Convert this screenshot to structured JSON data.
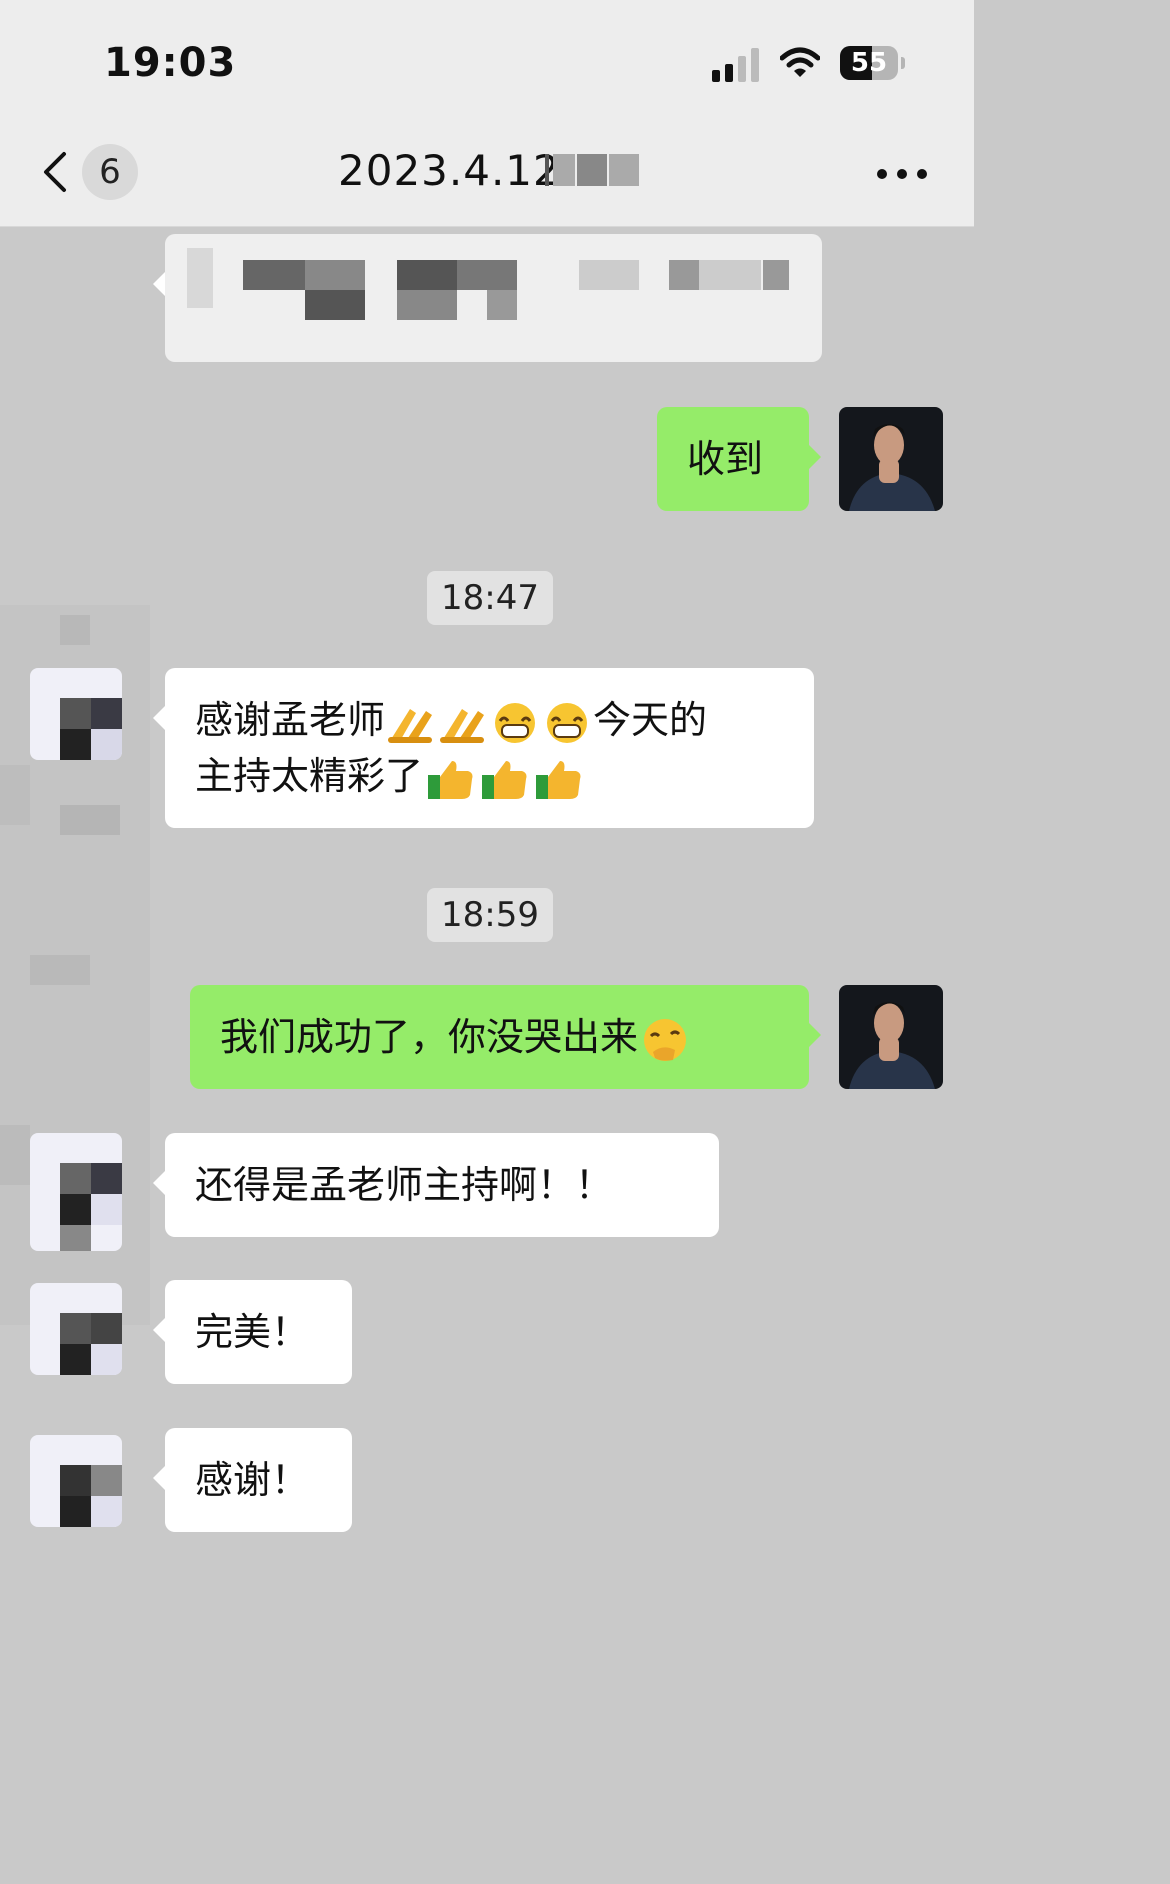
{
  "status_bar": {
    "time": "19:03",
    "battery_level": "55",
    "battery_fraction": 0.55
  },
  "nav": {
    "unread_count": "6",
    "title": "2023.4.12",
    "back_icon": "chevron-left-icon",
    "more_icon": "more-dots-icon"
  },
  "messages": [
    {
      "side": "right",
      "type": "text",
      "text": "收到"
    },
    {
      "type": "time",
      "text": "18:47"
    },
    {
      "side": "left",
      "type": "text",
      "text": [
        "感谢孟老师",
        "今天的",
        "主持太精彩了"
      ],
      "emoji": [
        "raised-hands-emoji",
        "raised-hands-emoji",
        "grinning-emoji",
        "grinning-emoji",
        "thumbs-up-emoji",
        "thumbs-up-emoji",
        "thumbs-up-emoji"
      ]
    },
    {
      "type": "time",
      "text": "18:59"
    },
    {
      "side": "right",
      "type": "text",
      "text": "我们成功了，你没哭出来",
      "emoji": [
        "blushing-hand-emoji"
      ]
    },
    {
      "side": "left",
      "type": "text",
      "text": "还得是孟老师主持啊！！"
    },
    {
      "side": "left",
      "type": "text",
      "text": "完美！"
    },
    {
      "side": "left",
      "type": "text",
      "text": "感谢！"
    }
  ],
  "colors": {
    "chat_bg": "#c9c9c9",
    "bar_bg": "#ededed",
    "outgoing_bubble": "#95ec69",
    "incoming_bubble": "#ffffff"
  }
}
